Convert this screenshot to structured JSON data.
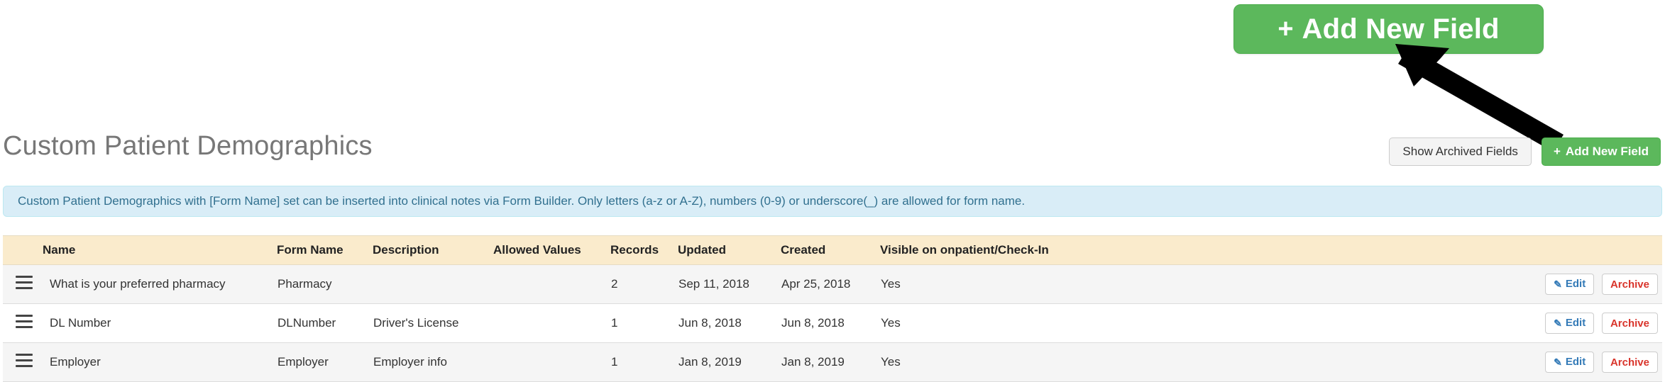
{
  "callout": {
    "add_new_field_label": "Add New Field",
    "plus_glyph": "+",
    "button_color": "#5cb85c"
  },
  "header": {
    "title": "Custom Patient Demographics",
    "show_archived_label": "Show Archived Fields",
    "add_new_field_label": "Add New Field",
    "plus_glyph": "+"
  },
  "alert": {
    "text": "Custom Patient Demographics with [Form Name] set can be inserted into clinical notes via Form Builder. Only letters (a-z or A-Z), numbers (0-9) or underscore(_) are allowed for form name.",
    "background_color": "#d9edf7",
    "text_color": "#31708f"
  },
  "table": {
    "header_background_color": "#faebcc",
    "columns": [
      "",
      "Name",
      "Form Name",
      "Description",
      "Allowed Values",
      "Records",
      "Updated",
      "Created",
      "Visible on onpatient/Check-In",
      ""
    ],
    "rows": [
      {
        "name": "What is your preferred pharmacy",
        "form_name": "Pharmacy",
        "description": "",
        "allowed_values": "",
        "records": "2",
        "updated": "Sep 11, 2018",
        "created": "Apr 25, 2018",
        "visible": "Yes",
        "edit_label": "Edit",
        "archive_label": "Archive"
      },
      {
        "name": "DL Number",
        "form_name": "DLNumber",
        "description": "Driver's License",
        "allowed_values": "",
        "records": "1",
        "updated": "Jun 8, 2018",
        "created": "Jun 8, 2018",
        "visible": "Yes",
        "edit_label": "Edit",
        "archive_label": "Archive"
      },
      {
        "name": "Employer",
        "form_name": "Employer",
        "description": "Employer info",
        "allowed_values": "",
        "records": "1",
        "updated": "Jan 8, 2019",
        "created": "Jan 8, 2019",
        "visible": "Yes",
        "edit_label": "Edit",
        "archive_label": "Archive"
      }
    ]
  }
}
